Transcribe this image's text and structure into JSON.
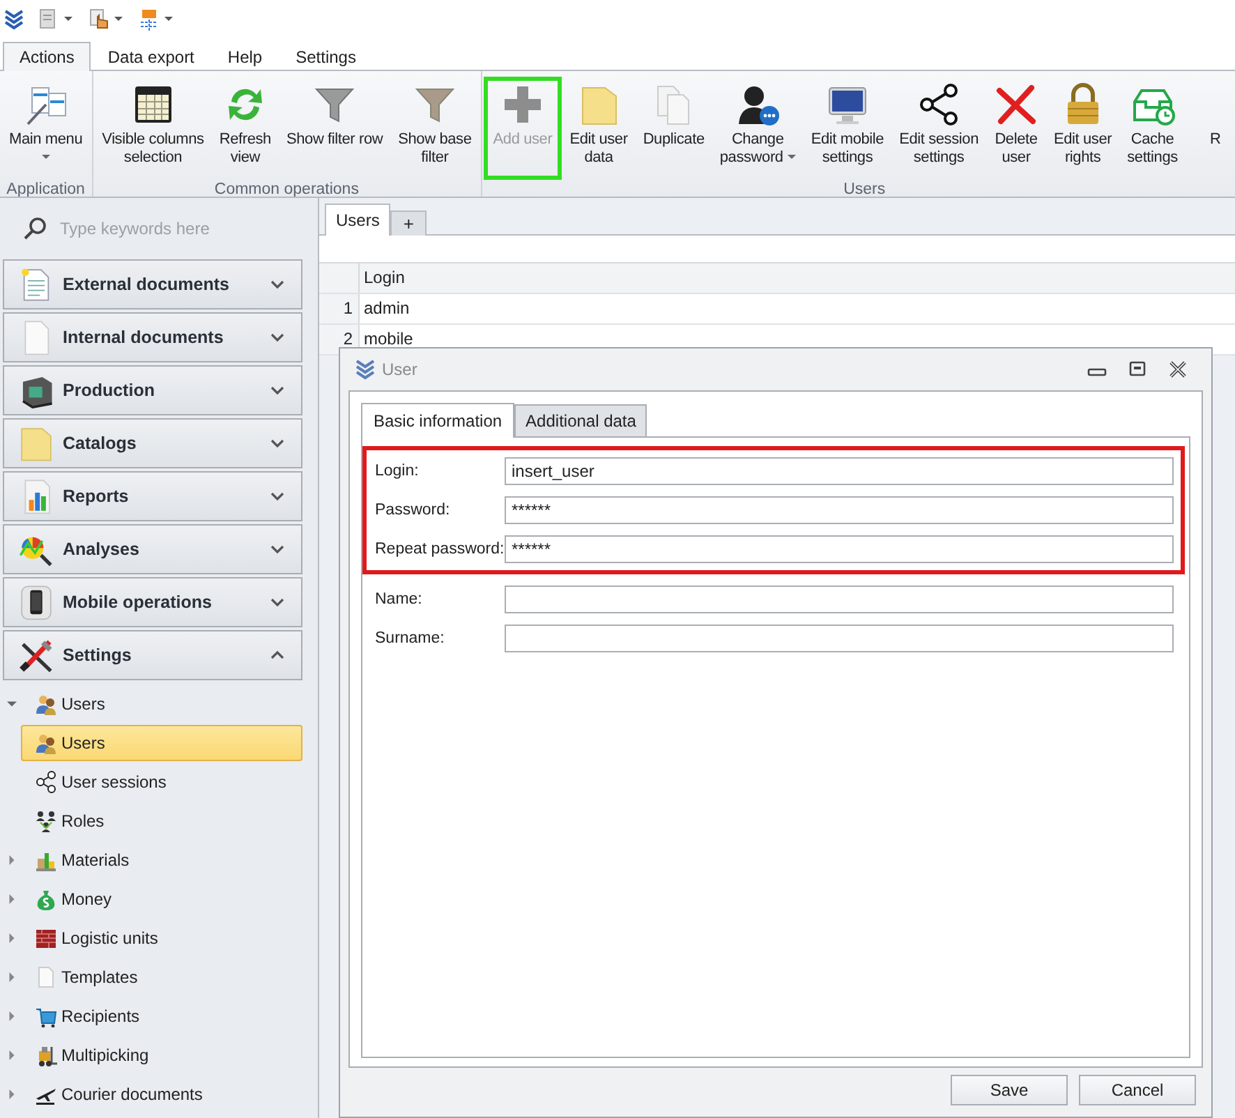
{
  "menu_tabs": [
    {
      "label": "Actions",
      "selected": true
    },
    {
      "label": "Data export",
      "selected": false
    },
    {
      "label": "Help",
      "selected": false
    },
    {
      "label": "Settings",
      "selected": false
    }
  ],
  "ribbon": {
    "groups": [
      {
        "label": "Application",
        "buttons": [
          {
            "label": "Main menu",
            "dropdown": true,
            "disabled": false,
            "highlighted": false
          }
        ]
      },
      {
        "label": "Common operations",
        "buttons": [
          {
            "label": "Visible columns\nselection",
            "dropdown": false,
            "disabled": false,
            "highlighted": false
          },
          {
            "label": "Refresh\nview",
            "dropdown": false,
            "disabled": false,
            "highlighted": false
          },
          {
            "label": "Show filter row",
            "dropdown": false,
            "disabled": false,
            "highlighted": false
          },
          {
            "label": "Show base\nfilter",
            "dropdown": false,
            "disabled": false,
            "highlighted": false
          }
        ]
      },
      {
        "label": "Users",
        "buttons": [
          {
            "label": "Add user",
            "dropdown": false,
            "disabled": true,
            "highlighted": true
          },
          {
            "label": "Edit user\ndata",
            "dropdown": false,
            "disabled": false,
            "highlighted": false
          },
          {
            "label": "Duplicate",
            "dropdown": false,
            "disabled": false,
            "highlighted": false
          },
          {
            "label": "Change\npassword",
            "dropdown": true,
            "disabled": false,
            "highlighted": false
          },
          {
            "label": "Edit mobile\nsettings",
            "dropdown": false,
            "disabled": false,
            "highlighted": false
          },
          {
            "label": "Edit session\nsettings",
            "dropdown": false,
            "disabled": false,
            "highlighted": false
          },
          {
            "label": "Delete\nuser",
            "dropdown": false,
            "disabled": false,
            "highlighted": false
          },
          {
            "label": "Edit user\nrights",
            "dropdown": false,
            "disabled": false,
            "highlighted": false
          },
          {
            "label": "Cache\nsettings",
            "dropdown": false,
            "disabled": false,
            "highlighted": false
          },
          {
            "label": "R",
            "dropdown": false,
            "disabled": false,
            "highlighted": false
          }
        ]
      }
    ]
  },
  "sidebar": {
    "search": {
      "placeholder": "Type keywords here"
    },
    "sections": [
      {
        "label": "External documents",
        "expanded": false
      },
      {
        "label": "Internal documents",
        "expanded": false
      },
      {
        "label": "Production",
        "expanded": false
      },
      {
        "label": "Catalogs",
        "expanded": false
      },
      {
        "label": "Reports",
        "expanded": false
      },
      {
        "label": "Analyses",
        "expanded": false
      },
      {
        "label": "Mobile operations",
        "expanded": false
      },
      {
        "label": "Settings",
        "expanded": true
      }
    ],
    "tree": [
      {
        "label": "Users",
        "expanded": true,
        "selected": false,
        "children": [
          {
            "label": "Users",
            "selected": true
          },
          {
            "label": "User sessions",
            "selected": false
          },
          {
            "label": "Roles",
            "selected": false
          }
        ]
      },
      {
        "label": "Materials",
        "expanded": false,
        "selected": false
      },
      {
        "label": "Money",
        "expanded": false,
        "selected": false
      },
      {
        "label": "Logistic units",
        "expanded": false,
        "selected": false
      },
      {
        "label": "Templates",
        "expanded": false,
        "selected": false
      },
      {
        "label": "Recipients",
        "expanded": false,
        "selected": false
      },
      {
        "label": "Multipicking",
        "expanded": false,
        "selected": false
      },
      {
        "label": "Courier documents",
        "expanded": false,
        "selected": false
      }
    ]
  },
  "document_tabs": [
    {
      "label": "Users",
      "selected": true
    }
  ],
  "add_tab": "+",
  "table": {
    "columns": [
      "Login"
    ],
    "rows": [
      {
        "number": "1",
        "login": "admin"
      },
      {
        "number": "2",
        "login": "mobile"
      }
    ]
  },
  "dialog": {
    "title": "User",
    "tabs": [
      {
        "label": "Basic information",
        "selected": true
      },
      {
        "label": "Additional data",
        "selected": false
      }
    ],
    "highlighted_fields": [
      {
        "label": "Login:",
        "value": "insert_user"
      },
      {
        "label": "Password:",
        "value": "******"
      },
      {
        "label": "Repeat password:",
        "value": "******"
      }
    ],
    "fields": [
      {
        "label": "Name:"
      },
      {
        "label": "Surname:"
      }
    ],
    "buttons": [
      "Save",
      "Cancel"
    ]
  }
}
